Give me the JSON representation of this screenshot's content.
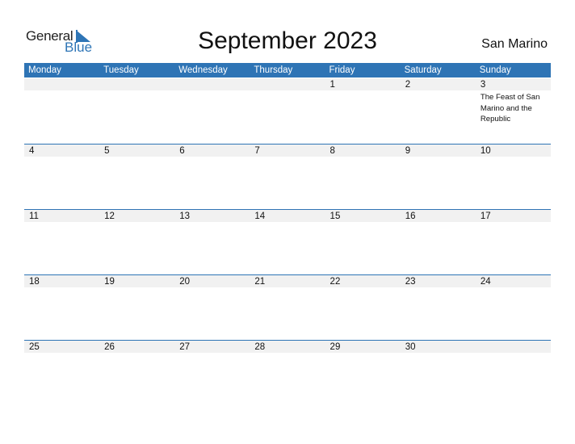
{
  "logo": {
    "general": "General",
    "blue": "Blue"
  },
  "title": "September 2023",
  "country": "San Marino",
  "weekdays": [
    "Monday",
    "Tuesday",
    "Wednesday",
    "Thursday",
    "Friday",
    "Saturday",
    "Sunday"
  ],
  "colors": {
    "accent": "#2e74b5",
    "date_bar": "#f1f1f1"
  },
  "weeks": [
    [
      {
        "d": ""
      },
      {
        "d": ""
      },
      {
        "d": ""
      },
      {
        "d": ""
      },
      {
        "d": "1"
      },
      {
        "d": "2"
      },
      {
        "d": "3",
        "event": "The Feast of San Marino and the Republic"
      }
    ],
    [
      {
        "d": "4"
      },
      {
        "d": "5"
      },
      {
        "d": "6"
      },
      {
        "d": "7"
      },
      {
        "d": "8"
      },
      {
        "d": "9"
      },
      {
        "d": "10"
      }
    ],
    [
      {
        "d": "11"
      },
      {
        "d": "12"
      },
      {
        "d": "13"
      },
      {
        "d": "14"
      },
      {
        "d": "15"
      },
      {
        "d": "16"
      },
      {
        "d": "17"
      }
    ],
    [
      {
        "d": "18"
      },
      {
        "d": "19"
      },
      {
        "d": "20"
      },
      {
        "d": "21"
      },
      {
        "d": "22"
      },
      {
        "d": "23"
      },
      {
        "d": "24"
      }
    ],
    [
      {
        "d": "25"
      },
      {
        "d": "26"
      },
      {
        "d": "27"
      },
      {
        "d": "28"
      },
      {
        "d": "29"
      },
      {
        "d": "30"
      },
      {
        "d": ""
      }
    ]
  ]
}
